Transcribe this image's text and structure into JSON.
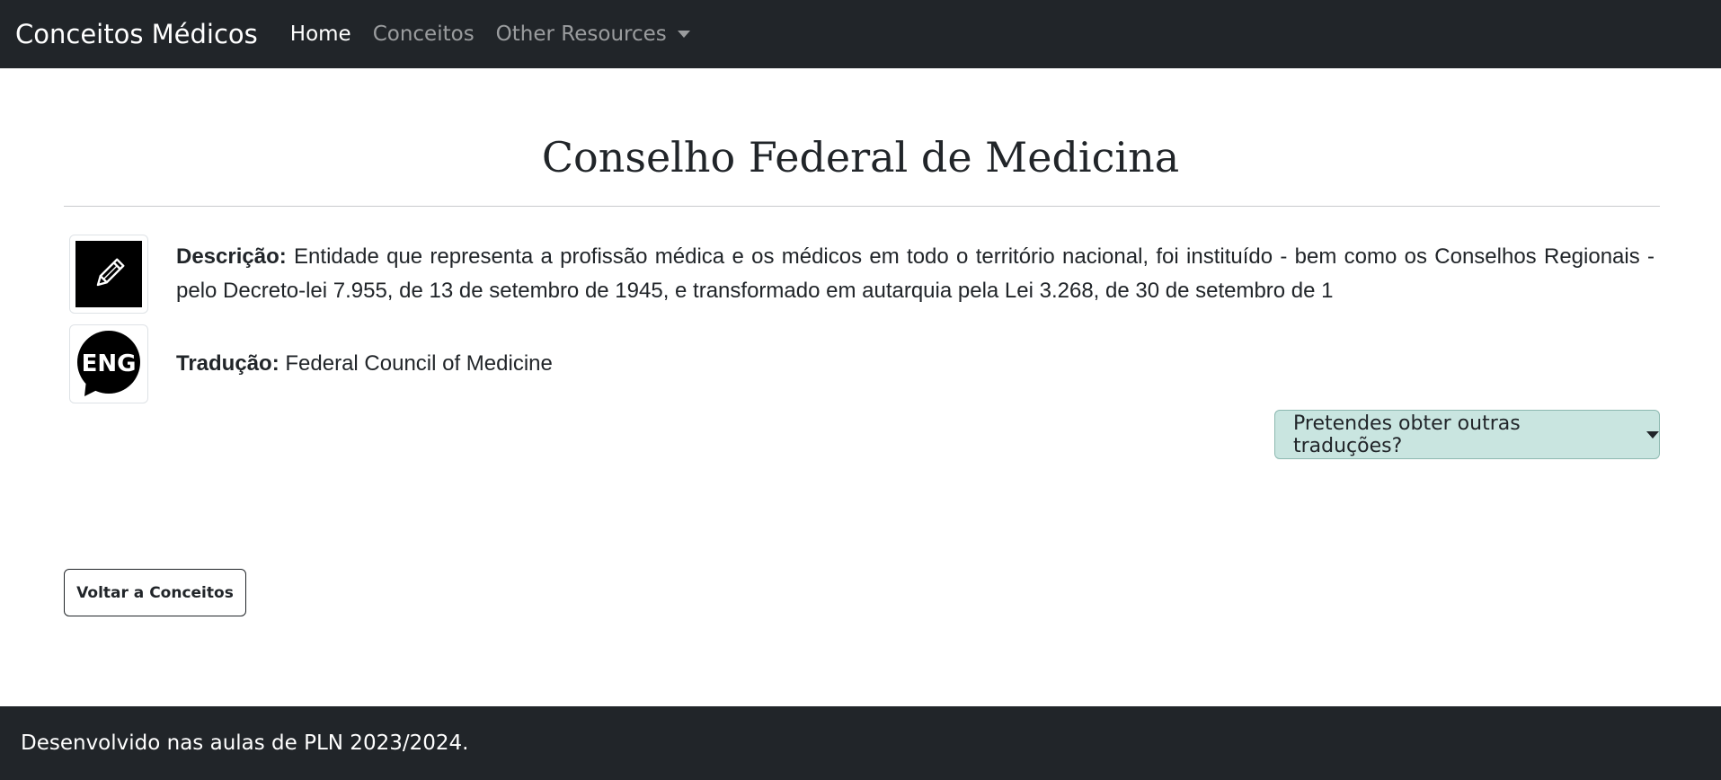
{
  "navbar": {
    "brand": "Conceitos Médicos",
    "links": [
      {
        "label": "Home",
        "active": true
      },
      {
        "label": "Conceitos",
        "active": false
      },
      {
        "label": "Other Resources",
        "active": false,
        "dropdown": true
      }
    ]
  },
  "main": {
    "title": "Conselho Federal de Medicina",
    "description": {
      "icon": "pencil-icon",
      "label": "Descrição:",
      "text": "Entidade que representa a profissão médica e os médicos em todo o território nacional, foi instituído - bem como os Conselhos Regionais - pelo Decreto-lei 7.955, de 13 de setembro de 1945, e transformado em autarquia pela Lei 3.268, de 30 de setembro de 1"
    },
    "translation": {
      "icon": "eng-speech-bubble-icon",
      "icon_text": "ENG",
      "label": "Tradução:",
      "text": "Federal Council of Medicine"
    },
    "translations_dropdown_label": "Pretendes obter outras traduções?",
    "back_button_label": "Voltar a Conceitos"
  },
  "footer": {
    "text": "Desenvolvido nas aulas de PLN 2023/2024."
  },
  "colors": {
    "navbar_bg": "#212529",
    "translate_button_bg": "#c9e5e0",
    "translate_button_border": "#8cb8b0"
  }
}
